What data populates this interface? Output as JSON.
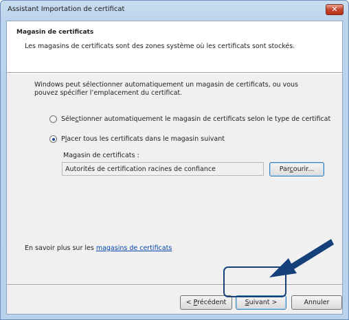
{
  "window": {
    "title": "Assistant Importation de certificat",
    "close_glyph": "✕"
  },
  "header": {
    "title": "Magasin de certificats",
    "description": "Les magasins de certificats sont des zones système où les certificats sont stockés."
  },
  "body": {
    "intro_line1": "Windows peut sélectionner automatiquement un magasin de certificats, ou vous",
    "intro_line2": "pouvez spécifier l’emplacement du certificat.",
    "option_auto": {
      "label_pre": "Séle",
      "label_access": "c",
      "label_post": "tionner automatiquement le magasin de certificats selon le type de certificat",
      "checked": false
    },
    "option_manual": {
      "label_pre": "P",
      "label_access": "l",
      "label_post": "acer tous les certificats dans le magasin suivant",
      "checked": true
    },
    "store_label": "Magasin de certificats :",
    "store_value": "Autorités de certification racines de confiance",
    "browse_pre": "Par",
    "browse_access": "c",
    "browse_post": "ourir...",
    "learn_prefix": "En savoir plus sur les ",
    "learn_link": "magasins de certificats"
  },
  "buttons": {
    "prev_pre": "< ",
    "prev_access": "P",
    "prev_post": "récédent",
    "next_access": "S",
    "next_post": "uivant >",
    "cancel": "Annuler"
  },
  "colors": {
    "annotation": "#15407a",
    "link": "#0645ad",
    "close_button": "#c6452c"
  },
  "icons": {
    "close": "close-icon",
    "pointer_arrow": "arrow-pointer-icon"
  }
}
